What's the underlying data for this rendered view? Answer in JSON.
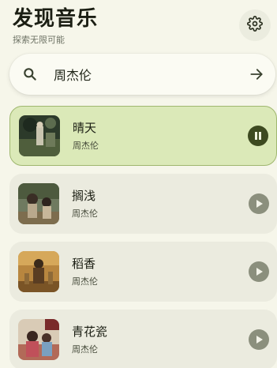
{
  "header": {
    "title": "发现音乐",
    "subtitle": "探索无限可能",
    "settings_icon": "gear-icon"
  },
  "search": {
    "icon": "search-icon",
    "value": "周杰伦",
    "submit_icon": "arrow-right-icon"
  },
  "colors": {
    "background": "#f6f6ea",
    "active_card": "#dbe9b8",
    "active_border": "#9fb76f",
    "card": "#ebebdf",
    "accent_dark": "#3d4a20",
    "muted_button": "#8b8f7d"
  },
  "songs": [
    {
      "title": "晴天",
      "artist": "周杰伦",
      "state": "playing",
      "button_icon": "pause-icon"
    },
    {
      "title": "搁浅",
      "artist": "周杰伦",
      "state": "idle",
      "button_icon": "play-icon"
    },
    {
      "title": "稻香",
      "artist": "周杰伦",
      "state": "idle",
      "button_icon": "play-icon"
    },
    {
      "title": "青花瓷",
      "artist": "周杰伦",
      "state": "idle",
      "button_icon": "play-icon"
    }
  ]
}
